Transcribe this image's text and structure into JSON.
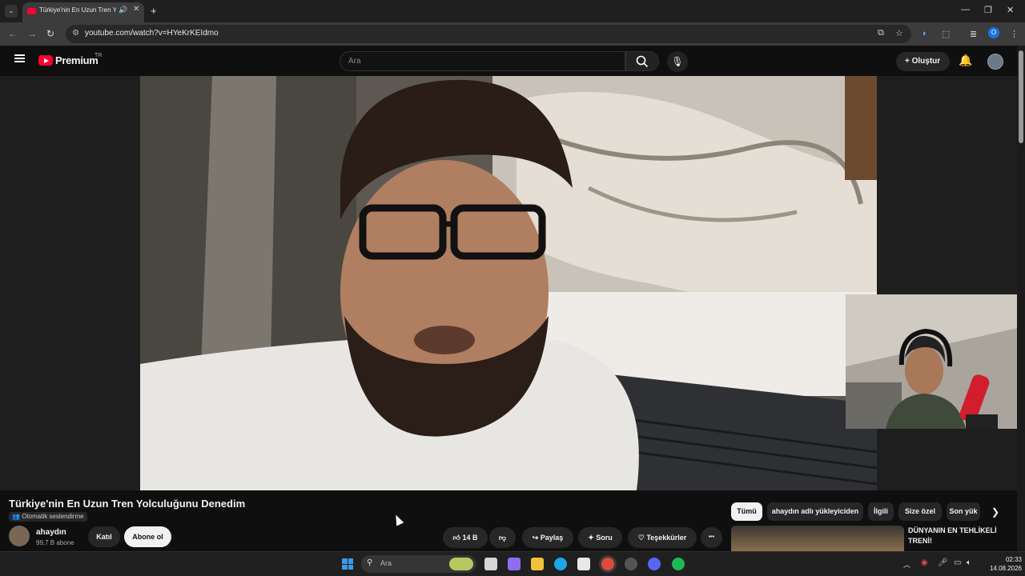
{
  "browser": {
    "tab_title": "Türkiye'nin En Uzun Tren Yo",
    "audio_icon": "speaker-icon",
    "close_glyph": "✕",
    "new_tab_glyph": "+",
    "url": "youtube.com/watch?v=HYeKrKEIdmo",
    "profile_initial": "O"
  },
  "youtube": {
    "brand": "Premium",
    "region": "TR",
    "search_placeholder": "Ara",
    "create_label": "Oluştur"
  },
  "video": {
    "title": "Türkiye'nin En Uzun Tren Yolculuğunu Denedim",
    "auto_dub": "Otomatik seslendirme",
    "channel_name": "ahaydın",
    "subscribers": "99,7 B abone",
    "join_label": "Katıl",
    "subscribe_label": "Abone ol",
    "likes": "14 B",
    "share_label": "Paylaş",
    "ask_label": "Soru",
    "thanks_label": "Teşekkürler",
    "more_glyph": "•••"
  },
  "chips": [
    "Tümü",
    "ahaydın adlı yükleyiciden",
    "İlgili",
    "Size özel",
    "Son yük"
  ],
  "recommendation": {
    "title": "DÜNYANIN EN TEHLİKELİ TRENİ!"
  },
  "taskbar": {
    "search_placeholder": "Ara",
    "time": "02:33",
    "date": "14.08.2026"
  },
  "colors": {
    "youtube_red": "#ff0033",
    "background": "#0f0f0f",
    "chip_bg": "#272727"
  }
}
